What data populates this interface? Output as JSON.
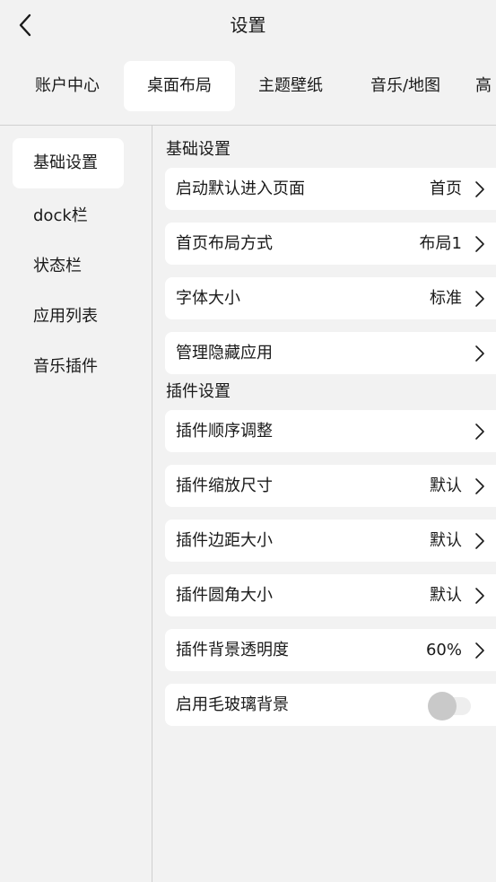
{
  "header": {
    "title": "设置"
  },
  "tabs": [
    {
      "label": "账户中心"
    },
    {
      "label": "桌面布局"
    },
    {
      "label": "主题壁纸"
    },
    {
      "label": "音乐/地图"
    },
    {
      "label": "高"
    }
  ],
  "sidebar": {
    "items": [
      {
        "label": "基础设置"
      },
      {
        "label": "dock栏"
      },
      {
        "label": "状态栏"
      },
      {
        "label": "应用列表"
      },
      {
        "label": "音乐插件"
      }
    ]
  },
  "sections": {
    "basic": {
      "title": "基础设置",
      "rows": [
        {
          "label": "启动默认进入页面",
          "value": "首页"
        },
        {
          "label": "首页布局方式",
          "value": "布局1"
        },
        {
          "label": "字体大小",
          "value": "标准"
        },
        {
          "label": "管理隐藏应用",
          "value": ""
        }
      ]
    },
    "plugin": {
      "title": "插件设置",
      "rows": [
        {
          "label": "插件顺序调整",
          "value": ""
        },
        {
          "label": "插件缩放尺寸",
          "value": "默认"
        },
        {
          "label": "插件边距大小",
          "value": "默认"
        },
        {
          "label": "插件圆角大小",
          "value": "默认"
        },
        {
          "label": "插件背景透明度",
          "value": "60%"
        }
      ],
      "toggle": {
        "label": "启用毛玻璃背景",
        "enabled": false
      }
    }
  },
  "icons": {
    "back": "chevron-left-icon",
    "row_arrow": "chevron-right-icon"
  },
  "colors": {
    "background": "#f2f2f2",
    "card": "#ffffff",
    "text": "#1a1a1a",
    "divider": "#cfcfcf",
    "toggle_off": "#c9c9c9"
  }
}
